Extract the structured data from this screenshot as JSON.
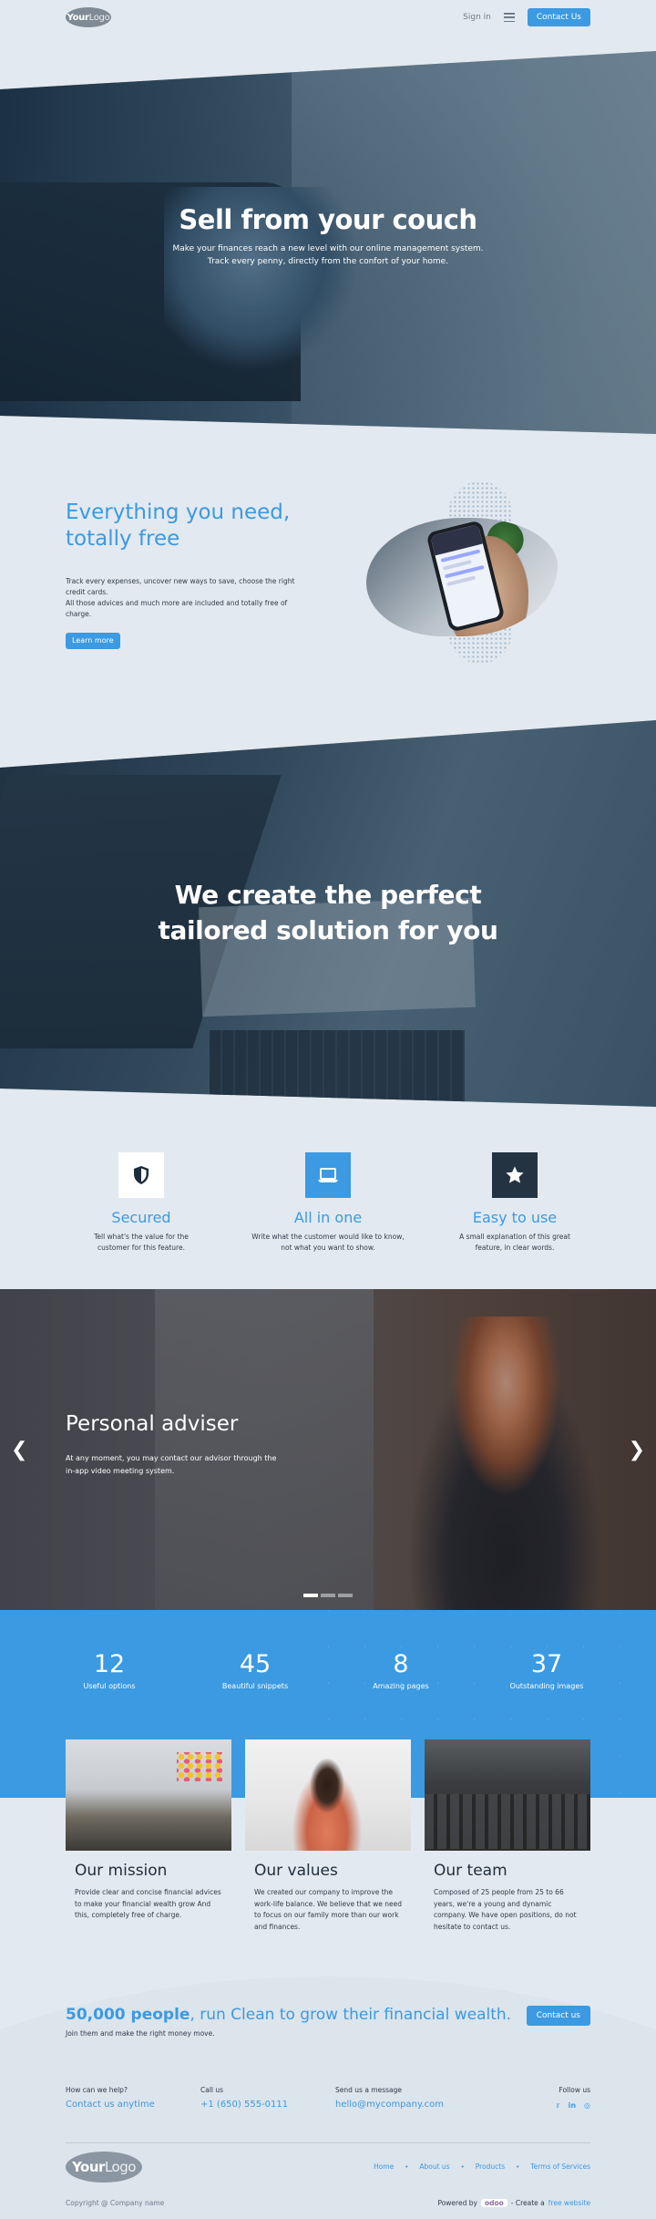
{
  "header": {
    "logo": {
      "text_bold": "Your",
      "text_light": "Logo"
    },
    "signin_label": "Sign in",
    "contact_label": "Contact Us"
  },
  "hero": {
    "title": "Sell from your couch",
    "subtitle_line1": "Make your finances reach a new level with our online management system.",
    "subtitle_line2": "Track every penny, directly from the confort of your home."
  },
  "everything": {
    "title_line1": "Everything you need,",
    "title_line2": "totally free",
    "body_line1": "Track every expenses, uncover new ways to save, choose the right credit cards.",
    "body_line2": "All those advices and much more are included and totally free of charge.",
    "button_label": "Learn more"
  },
  "tailored": {
    "title_line1": "We create the perfect",
    "title_line2": "tailored solution for you"
  },
  "features": [
    {
      "icon": "shield-icon",
      "title": "Secured",
      "desc_line1": "Tell what's the value for the",
      "desc_line2": "customer for this feature.",
      "icon_bg": "#ffffff",
      "icon_fg": "#1f2d3a"
    },
    {
      "icon": "laptop-icon",
      "title": "All in one",
      "desc_line1": "Write what the customer would like to know,",
      "desc_line2": "not what you want to show.",
      "icon_bg": "#3b9ae1",
      "icon_fg": "#ffffff"
    },
    {
      "icon": "star-icon",
      "title": "Easy to use",
      "desc_line1": "A small explanation of this great",
      "desc_line2": "feature, in clear words.",
      "icon_bg": "#243342",
      "icon_fg": "#ffffff"
    }
  ],
  "adviser": {
    "title": "Personal adviser",
    "desc_line1": "At any moment, you may contact our advisor through the",
    "desc_line2": "in-app video meeting system.",
    "active_slide": 1,
    "slide_count": 3
  },
  "stats": [
    {
      "number": "12",
      "label": "Useful options"
    },
    {
      "number": "45",
      "label": "Beautiful snippets"
    },
    {
      "number": "8",
      "label": "Amazing pages"
    },
    {
      "number": "37",
      "label": "Outstanding images"
    }
  ],
  "cards": [
    {
      "title": "Our mission",
      "text": "Provide clear and concise financial advices to make your financial wealth grow And this, completely free of charge."
    },
    {
      "title": "Our values",
      "text": "We created our company to improve the work-life balance. We believe that we need to focus on our family more than our work and finances."
    },
    {
      "title": "Our team",
      "text": "Composed of 25 people from 25 to 66 years, we're a young and dynamic company. We have open positions, do not hesitate to contact us."
    }
  ],
  "cta": {
    "title_bold": "50,000 people",
    "title_rest": ", run Clean to grow their financial wealth.",
    "subtitle": "Join them and make the right money move.",
    "button_label": "Contact us"
  },
  "contacts": {
    "help_label": "How can we help?",
    "help_value": "Contact us anytime",
    "call_label": "Call us",
    "call_value": "+1 (650) 555-0111",
    "message_label": "Send us a message",
    "message_value": "hello@mycompany.com",
    "follow_label": "Follow us"
  },
  "footer": {
    "logo": {
      "text_bold": "Your",
      "text_light": "Logo"
    },
    "nav": [
      "Home",
      "About us",
      "Products",
      "Terms of Services"
    ],
    "copyright": "Copyright @ Company name",
    "powered_prefix": "Powered by",
    "powered_brand": "odoo",
    "powered_middle": "- Create a",
    "powered_link": "free website"
  },
  "colors": {
    "accent": "#3b9ae1",
    "dark": "#243342",
    "background": "#e3e9f0"
  }
}
